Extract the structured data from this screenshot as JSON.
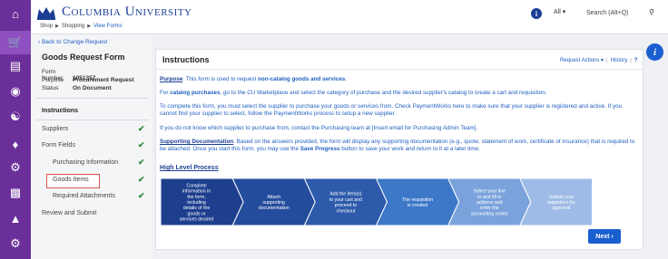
{
  "header": {
    "logo_text": "Columbia University",
    "breadcrumb": [
      "Shop",
      "Shopping",
      "View Forms"
    ],
    "scope_label": "All ▾",
    "search_placeholder": "Search (Alt+Q)"
  },
  "left_panel": {
    "back_link": "‹ Back to Change Request",
    "form_title": "Goods Request Form",
    "meta": [
      {
        "label": "Form Number",
        "value": "1051357"
      },
      {
        "label": "Purpose",
        "value": "Procurement Request"
      },
      {
        "label": "Status",
        "value": "On Document"
      }
    ],
    "nav": [
      {
        "label": "Instructions",
        "checked": false
      },
      {
        "label": "Suppliers",
        "checked": true
      },
      {
        "label": "Form Fields",
        "checked": true
      },
      {
        "label": "Purchasing Information",
        "checked": true
      },
      {
        "label": "Goods Items",
        "checked": true,
        "highlighted": true
      },
      {
        "label": "Required Attachments",
        "checked": true
      },
      {
        "label": "Review and Submit",
        "checked": false
      }
    ]
  },
  "main": {
    "title": "Instructions",
    "actions_label": "Request Actions ▾",
    "history_label": "History",
    "help_label": "?",
    "paragraphs": {
      "p1_lead": "Purpose",
      "p1_a": ": This form is used to request ",
      "p1_bold": "non-catalog goods and services",
      "p1_b": ".",
      "p2_a": "For ",
      "p2_bold": "catalog purchases",
      "p2_b": ", go to the CU Marketplace and select the category of purchase and the desired supplier's catalog to create a cart and requisition.",
      "p3": "To complete this form, you must select the supplier to purchase your goods or services from. Check PaymentWorks here to make sure that your supplier is registered and active. If you cannot find your supplier to select, follow the PaymentWorks process to setup a new supplier.",
      "p4": "If you do not know which supplier to purchase from, contact the Purchasing team at [Insert email for Purchasing Admin Team].",
      "p5_lead": "Supporting Documentation",
      "p5_a": ": Based on the answers provided, the form will display any supporting documentation (e.g., quote, statement of work, certificate of insurance) that is required to be attached. Once you start this form, you may use the ",
      "p5_bold": "Save Progress",
      "p5_b": " button to save your work and return to it at a later time."
    },
    "high_level_process": "High Level Process",
    "steps": [
      "Complete information in the form, including details of the goods or services desired",
      "Attach supporting documentation",
      "Add the item(s) to your cart and proceed to checkout",
      "The requisition is created",
      "Select your line to and fill in address and enter the accounting codes",
      "Submit your requisition for approval"
    ],
    "next_label": "Next ›"
  },
  "colors": {
    "rail": "#6b2f9a",
    "brand": "#1c3f94",
    "link": "#1f5fbf",
    "check": "#2e8b3d",
    "highlight": "#d9534f",
    "steps": [
      "#1d3f8e",
      "#234c9c",
      "#2d5aab",
      "#3d78c8",
      "#7aa3dc",
      "#9dbbe6"
    ]
  }
}
